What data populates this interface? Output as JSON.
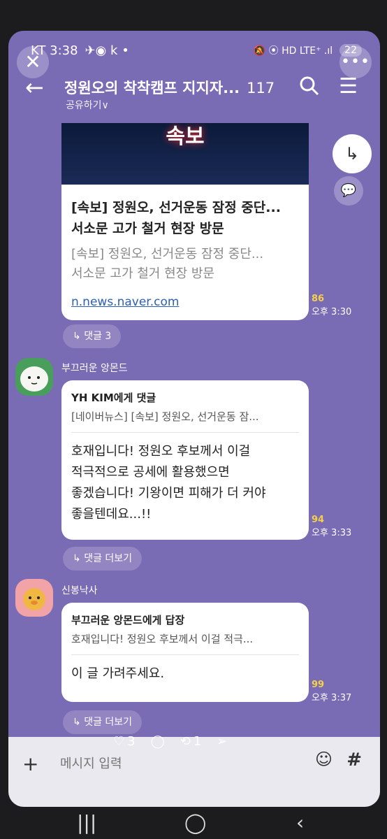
{
  "status": {
    "carrier_time": "KT 3:38",
    "left_icons": "✈◉ k •",
    "right_icons": "🔕 ⦿ HD LTE⁺ .ıl",
    "battery": "22"
  },
  "header": {
    "title": "정원오의 착착캠프 지지자...",
    "member_count": "117",
    "share_label": "공유하기"
  },
  "link_card": {
    "image_text": "속보",
    "title_line1": "[속보] 정원오, 선거운동 잠정 중단...",
    "title_line2": "서소문 고가 철거 현장 방문",
    "desc_line1": "[속보] 정원오, 선거운동 잠정 중단...",
    "desc_line2": "서소문 고가 철거 현장 방문",
    "url": "n.news.naver.com",
    "unread": "86",
    "time": "오후 3:30",
    "reply_label": "댓글 3"
  },
  "messages": [
    {
      "sender": "부끄러운 앙몬드",
      "reply_to": "YH KIM에게 댓글",
      "quoted": "[네이버뉴스] [속보] 정원오, 선거운동 잠...",
      "line1": "호재입니다! 정원오 후보께서 이걸",
      "line2": "적극적으로 공세에 활용했으면",
      "line3": "좋겠습니다! 기왕이면 피해가 더 커야",
      "line4": "좋을텐데요...!!",
      "unread": "94",
      "time": "오후 3:33",
      "more_label": "댓글 더보기"
    },
    {
      "sender": "신봉낙사",
      "reply_to": "부끄러운 앙몬드에게 답장",
      "quoted": "호재입니다! 정원오 후보께서 이걸 적극...",
      "line1": "이 글 가려주세요.",
      "unread": "99",
      "time": "오후 3:37",
      "more_label": "댓글 더보기"
    }
  ],
  "overlay": {
    "likes": "3",
    "reposts": "1"
  },
  "input": {
    "placeholder": "메시지 입력"
  }
}
